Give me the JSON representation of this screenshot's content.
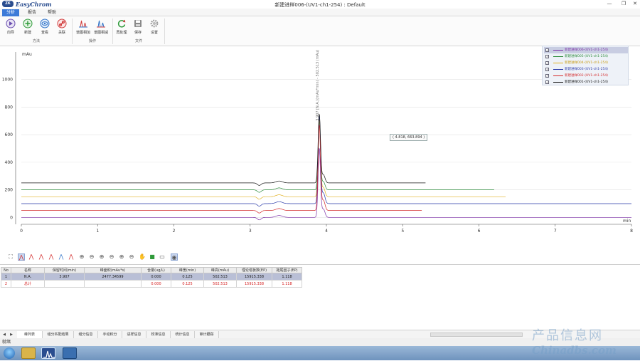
{
  "window": {
    "app_name": "EasyChrom",
    "logo_text": "ZK",
    "title": "新建进样006-(UV1-ch1-254)  : Default",
    "minimize": "—",
    "restore": "❐",
    "close": "✕"
  },
  "menu": {
    "tabs": [
      {
        "label": "分析"
      },
      {
        "label": "报告"
      },
      {
        "label": "帮助"
      }
    ]
  },
  "ribbon": {
    "groups": [
      {
        "label": "方法"
      },
      {
        "label": "操作"
      },
      {
        "label": "文件"
      }
    ],
    "buttons": [
      {
        "label": "向导",
        "icon": "wizard-icon"
      },
      {
        "label": "新建",
        "icon": "add-icon"
      },
      {
        "label": "查看",
        "icon": "eye-icon"
      },
      {
        "label": "关联",
        "icon": "link-icon"
      },
      {
        "label": "谱图相加",
        "icon": "spectrum-add-icon"
      },
      {
        "label": "谱图相减",
        "icon": "spectrum-subtract-icon"
      },
      {
        "label": "再处理",
        "icon": "reprocess-icon"
      },
      {
        "label": "保存",
        "icon": "save-icon"
      },
      {
        "label": "设置",
        "icon": "gear-icon"
      }
    ]
  },
  "chart_data": {
    "type": "line",
    "ylabel": "mAu",
    "xlabel": "min",
    "xlim": [
      0,
      8
    ],
    "ylim": [
      -50,
      1200
    ],
    "xticks": [
      0,
      1,
      2,
      3,
      4,
      5,
      6,
      7,
      8
    ],
    "yticks": [
      0,
      200,
      400,
      600,
      800,
      1000
    ],
    "grid": true,
    "legend_position": "top-right",
    "peak_annotation": "3.907 [N.A.](mAu*min) - 502.513 (mAu)",
    "tooltip": "( 4.818, 663.894 )",
    "series": [
      {
        "name": "新建进样006-(UV1-ch1-254)",
        "color": "#7b2fa6",
        "offset": 0,
        "peak": 502.5,
        "end": 8.0
      },
      {
        "name": "新建进样005-(UV1-ch1-254)",
        "color": "#2a8a3a",
        "offset": 200,
        "peak": 500,
        "end": 6.2
      },
      {
        "name": "新建进样004-(UV1-ch1-254)",
        "color": "#e0b020",
        "offset": 150,
        "peak": 560,
        "end": 6.35
      },
      {
        "name": "新建进样003-(UV1-ch1-254)",
        "color": "#2a3aa8",
        "offset": 100,
        "peak": 640,
        "end": 8.0
      },
      {
        "name": "新建进样002-(UV1-ch1-254)",
        "color": "#d42a2a",
        "offset": 50,
        "peak": 620,
        "end": 5.25
      },
      {
        "name": "新建进样001-(UV1-ch1-254)",
        "color": "#111111",
        "offset": 250,
        "peak": 500,
        "end": 5.3
      }
    ]
  },
  "plot_tools": [
    {
      "icon": "fit-view-icon",
      "glyph": "⛶"
    },
    {
      "icon": "peak-select-icon",
      "glyph": "⋀"
    },
    {
      "icon": "peak-add-icon",
      "glyph": "⋀"
    },
    {
      "icon": "peak-split-icon",
      "glyph": "⋀"
    },
    {
      "icon": "peak-merge-icon",
      "glyph": "⋀"
    },
    {
      "icon": "baseline-icon",
      "glyph": "⋀"
    },
    {
      "icon": "peak-delete-icon",
      "glyph": "⋀"
    },
    {
      "icon": "zoom-in-icon",
      "glyph": "⊕"
    },
    {
      "icon": "zoom-out-icon",
      "glyph": "⊖"
    },
    {
      "icon": "zoom-in-x-icon",
      "glyph": "⊕"
    },
    {
      "icon": "zoom-out-x-icon",
      "glyph": "⊖"
    },
    {
      "icon": "zoom-in-y-icon",
      "glyph": "⊕"
    },
    {
      "icon": "zoom-out-y-icon",
      "glyph": "⊖"
    },
    {
      "icon": "pan-hand-icon",
      "glyph": "✋"
    },
    {
      "icon": "color-icon",
      "glyph": "■"
    },
    {
      "icon": "ruler-icon",
      "glyph": "▭"
    },
    {
      "icon": "cursor-icon",
      "glyph": "◉"
    }
  ],
  "results_table": {
    "columns": [
      "No",
      "名称",
      "保留时间(min)",
      "峰面积(mAu*s)",
      "含量(ug/L)",
      "峰宽(min)",
      "峰高(mAu)",
      "理论塔板数(EP)",
      "拖尾因子(EP)"
    ],
    "rows": [
      [
        "1",
        "N.A.",
        "3.907",
        "2477.34599",
        "0.000",
        "0.125",
        "502.513",
        "15915.338",
        "1.118"
      ],
      [
        "2",
        "总计",
        "",
        "",
        "0.000",
        "0.125",
        "502.513",
        "15915.338",
        "1.118"
      ]
    ]
  },
  "bottom_tabs": [
    {
      "label": "峰列表"
    },
    {
      "label": "组分匹配结果"
    },
    {
      "label": "组分信息"
    },
    {
      "label": "手动积分"
    },
    {
      "label": "进样信息"
    },
    {
      "label": "校准信息"
    },
    {
      "label": "统计信息"
    },
    {
      "label": "审计跟踪"
    }
  ],
  "status": {
    "text": "就绪"
  },
  "watermark": {
    "line1": "产品信息网",
    "line2": "Chinadbs.com"
  }
}
